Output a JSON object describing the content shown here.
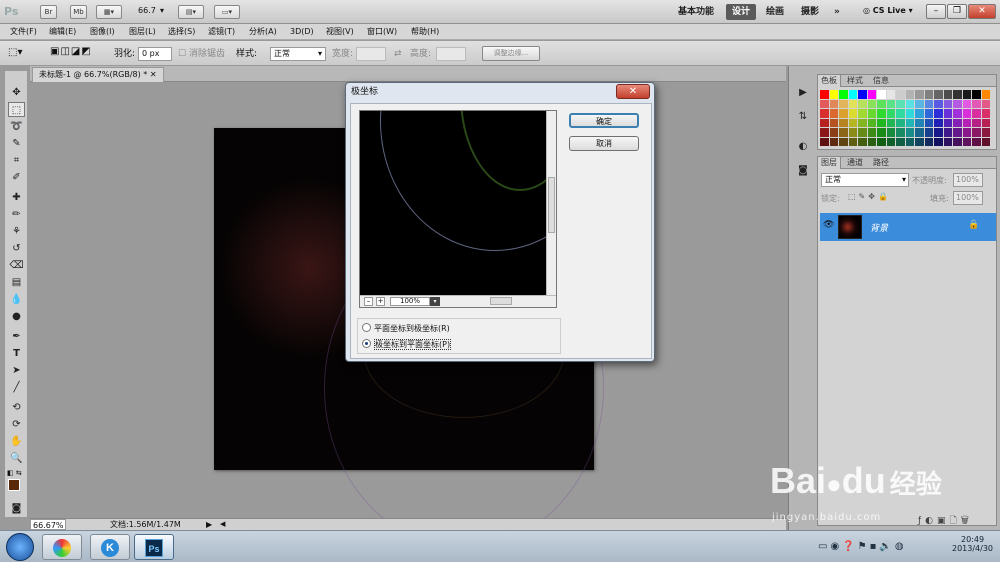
{
  "appbar": {
    "logo": "Ps",
    "br": "Br",
    "mb": "Mb",
    "zoom": "66.7",
    "workspaces": [
      "基本功能",
      "设计",
      "绘画",
      "摄影"
    ],
    "more": "»",
    "cslive": "CS Live"
  },
  "menus": [
    "文件(F)",
    "编辑(E)",
    "图像(I)",
    "图层(L)",
    "选择(S)",
    "滤镜(T)",
    "分析(A)",
    "3D(D)",
    "视图(V)",
    "窗口(W)",
    "帮助(H)"
  ],
  "options": {
    "feather_label": "羽化:",
    "feather_value": "0 px",
    "antialias": "消除锯齿",
    "style_label": "样式:",
    "style_value": "正常",
    "width_label": "宽度:",
    "height_label": "高度:",
    "refine_button": "调整边缘..."
  },
  "document": {
    "tab_title": "未标题-1 @ 66.7%(RGB/8) *",
    "zoom": "66.67%",
    "doc_info": "文档:1.56M/1.47M"
  },
  "dialog": {
    "title": "极坐标",
    "ok": "确定",
    "cancel": "取消",
    "zoom": "100%",
    "option1": "平面坐标到极坐标(R)",
    "option2": "极坐标到平面坐标(P)",
    "selected": 2
  },
  "panels": {
    "color_tabs": [
      "色板",
      "样式",
      "信息"
    ],
    "layer_tabs": [
      "图层",
      "通道",
      "路径"
    ],
    "blend_mode": "正常",
    "opacity_label": "不透明度:",
    "opacity": "100%",
    "lock_label": "锁定:",
    "fill_label": "填充:",
    "fill": "100%",
    "layer_name": "背景"
  },
  "taskbar": {
    "time": "20:49",
    "date": "2013/4/30"
  },
  "watermark": {
    "brand": "Bai",
    "brand2": "du",
    "suffix": "经验",
    "url": "jingyan.baidu.com"
  },
  "colors": {
    "selected_layer": "#3c8cdc",
    "foreground": "#5a2a08",
    "background": "#000000"
  }
}
